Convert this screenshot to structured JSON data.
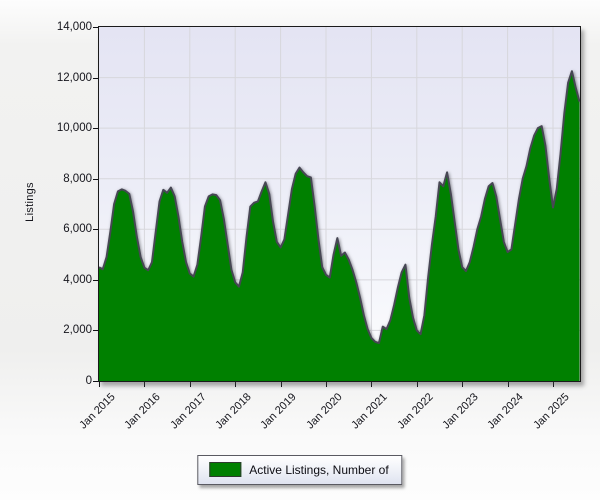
{
  "legend": {
    "label": "Active Listings, Number of",
    "swatch_color": "#008000"
  },
  "colors": {
    "area_fill": "#008000",
    "area_outline": "#474754",
    "gridline": "#d7d7dc",
    "plot_border": "#1b1b1b",
    "axis_text": "#15151c"
  },
  "chart_data": {
    "type": "area",
    "title": "",
    "xlabel": "",
    "ylabel": "Listings",
    "ylim": [
      0,
      14000
    ],
    "grid": true,
    "legend_position": "bottom",
    "y_tick_values": [
      0,
      2000,
      4000,
      6000,
      8000,
      10000,
      12000,
      14000
    ],
    "y_tick_labels": [
      "0",
      "2,000",
      "4,000",
      "6,000",
      "8,000",
      "10,000",
      "12,000",
      "14,000"
    ],
    "x_tick_labels": [
      "Jan 2015",
      "Jan 2016",
      "Jan 2017",
      "Jan 2018",
      "Jan 2019",
      "Jan 2020",
      "Jan 2021",
      "Jan 2022",
      "Jan 2023",
      "Jan 2024",
      "Jan 2025"
    ],
    "x_tick_month_index": [
      0,
      12,
      24,
      36,
      48,
      60,
      72,
      84,
      96,
      108,
      120
    ],
    "series": [
      {
        "name": "Active Listings, Number of",
        "color": "#008000",
        "start_month": "Jan 2015",
        "frequency": "monthly",
        "values": [
          4500,
          4420,
          4900,
          5900,
          7000,
          7500,
          7580,
          7520,
          7400,
          6700,
          5700,
          4900,
          4480,
          4380,
          4700,
          5900,
          7100,
          7560,
          7440,
          7650,
          7300,
          6500,
          5500,
          4700,
          4250,
          4130,
          4600,
          5700,
          6900,
          7300,
          7380,
          7350,
          7150,
          6400,
          5400,
          4400,
          3900,
          3730,
          4300,
          5700,
          6900,
          7050,
          7100,
          7500,
          7860,
          7400,
          6300,
          5500,
          5280,
          5600,
          6600,
          7600,
          8200,
          8440,
          8250,
          8100,
          8050,
          6900,
          5600,
          4500,
          4200,
          4090,
          5000,
          5650,
          4950,
          5080,
          4800,
          4400,
          3900,
          3300,
          2600,
          2050,
          1700,
          1550,
          1500,
          2150,
          2050,
          2400,
          3000,
          3700,
          4300,
          4600,
          3300,
          2500,
          2000,
          1850,
          2600,
          4100,
          5400,
          6500,
          7860,
          7700,
          8250,
          7400,
          6300,
          5200,
          4500,
          4350,
          4700,
          5300,
          6000,
          6500,
          7200,
          7700,
          7830,
          7300,
          6400,
          5500,
          5100,
          5200,
          6200,
          7200,
          8000,
          8500,
          9200,
          9700,
          10000,
          10080,
          9300,
          8000,
          6860,
          7600,
          9000,
          10600,
          11800,
          12250,
          11600,
          11050
        ]
      }
    ]
  }
}
